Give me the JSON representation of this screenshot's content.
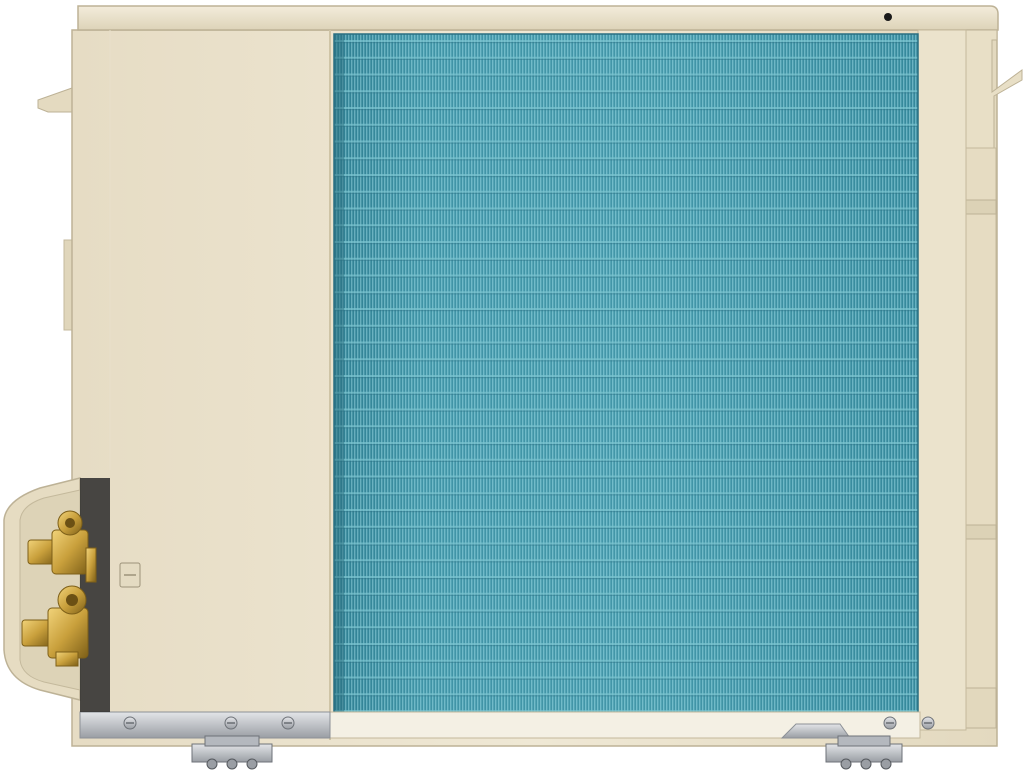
{
  "image": {
    "subject": "air-conditioner-outdoor-unit",
    "view": "rear"
  },
  "colors": {
    "casing": "#ece4cf",
    "casing_shadow": "#d9cfb4",
    "casing_edge": "#bdb296",
    "coil": "#3f94a8",
    "coil_light": "#7cc4d0",
    "coil_dark": "#2a6f82",
    "brass": "#c9a03c",
    "brass_dark": "#8a6a1e",
    "metal": "#c8cbd0",
    "metal_dark": "#8c9096",
    "background": "#ffffff"
  },
  "parts": {
    "coil_rows": 41,
    "screws_visible": 6,
    "service_valves": 2
  }
}
